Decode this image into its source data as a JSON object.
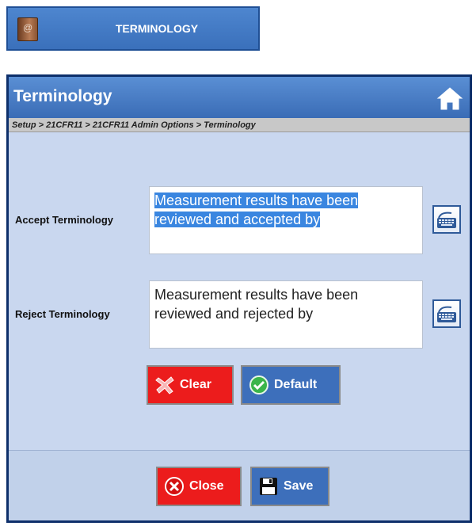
{
  "menu_button": {
    "label": "TERMINOLOGY",
    "icon": "address-book-icon"
  },
  "dialog": {
    "title": "Terminology",
    "home_icon": "home-icon",
    "breadcrumb": "Setup > 21CFR11 > 21CFR11 Admin Options > Terminology",
    "accept": {
      "label": "Accept Terminology",
      "value": "Measurement results have been reviewed and accepted by"
    },
    "reject": {
      "label": "Reject Terminology",
      "value": "Measurement results have been reviewed and rejected by"
    },
    "buttons": {
      "clear": "Clear",
      "default": "Default",
      "close": "Close",
      "save": "Save"
    }
  },
  "colors": {
    "header_blue": "#3a6cb6",
    "panel_bg": "#c9d7ef",
    "clear_red": "#ec1c1c",
    "default_blue": "#3d6fbb",
    "selection_blue": "#3a86e0"
  }
}
